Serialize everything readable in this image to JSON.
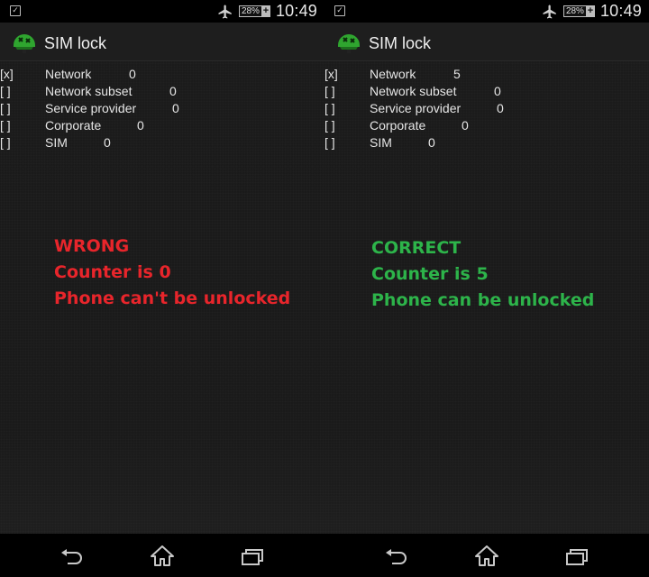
{
  "screens": [
    {
      "id": "left",
      "status_bar": {
        "notification_icon": "checkbox-icon",
        "airplane_icon": "airplane-icon",
        "battery_percent": "28%",
        "battery_charging_glyph": "+",
        "time": "10:49"
      },
      "action_bar": {
        "app_icon": "sim-lock-app-icon",
        "title": "SIM lock"
      },
      "locks": [
        {
          "check": "[x]",
          "label": "Network",
          "count": "0"
        },
        {
          "check": "[ ]",
          "label": "Network subset",
          "count": "0"
        },
        {
          "check": "[ ]",
          "label": "Service provider",
          "count": "0"
        },
        {
          "check": "[ ]",
          "label": "Corporate",
          "count": "0"
        },
        {
          "check": "[ ]",
          "label": "SIM",
          "count": "0"
        }
      ],
      "annotation": {
        "color": "#e8252b",
        "lines": [
          "WRONG",
          "Counter is 0",
          "Phone can't be unlocked"
        ]
      },
      "nav_bar": {
        "back": "back-icon",
        "home": "home-icon",
        "recents": "recents-icon"
      }
    },
    {
      "id": "right",
      "status_bar": {
        "notification_icon": "checkbox-icon",
        "airplane_icon": "airplane-icon",
        "battery_percent": "28%",
        "battery_charging_glyph": "+",
        "time": "10:49"
      },
      "action_bar": {
        "app_icon": "sim-lock-app-icon",
        "title": "SIM lock"
      },
      "locks": [
        {
          "check": "[x]",
          "label": "Network",
          "count": "5"
        },
        {
          "check": "[ ]",
          "label": "Network subset",
          "count": "0"
        },
        {
          "check": "[ ]",
          "label": "Service provider",
          "count": "0"
        },
        {
          "check": "[ ]",
          "label": "Corporate",
          "count": "0"
        },
        {
          "check": "[ ]",
          "label": "SIM",
          "count": "0"
        }
      ],
      "annotation": {
        "color": "#2db44a",
        "lines": [
          "CORRECT",
          "Counter is 5",
          "Phone can be unlocked"
        ]
      },
      "nav_bar": {
        "back": "back-icon",
        "home": "home-icon",
        "recents": "recents-icon"
      }
    }
  ]
}
